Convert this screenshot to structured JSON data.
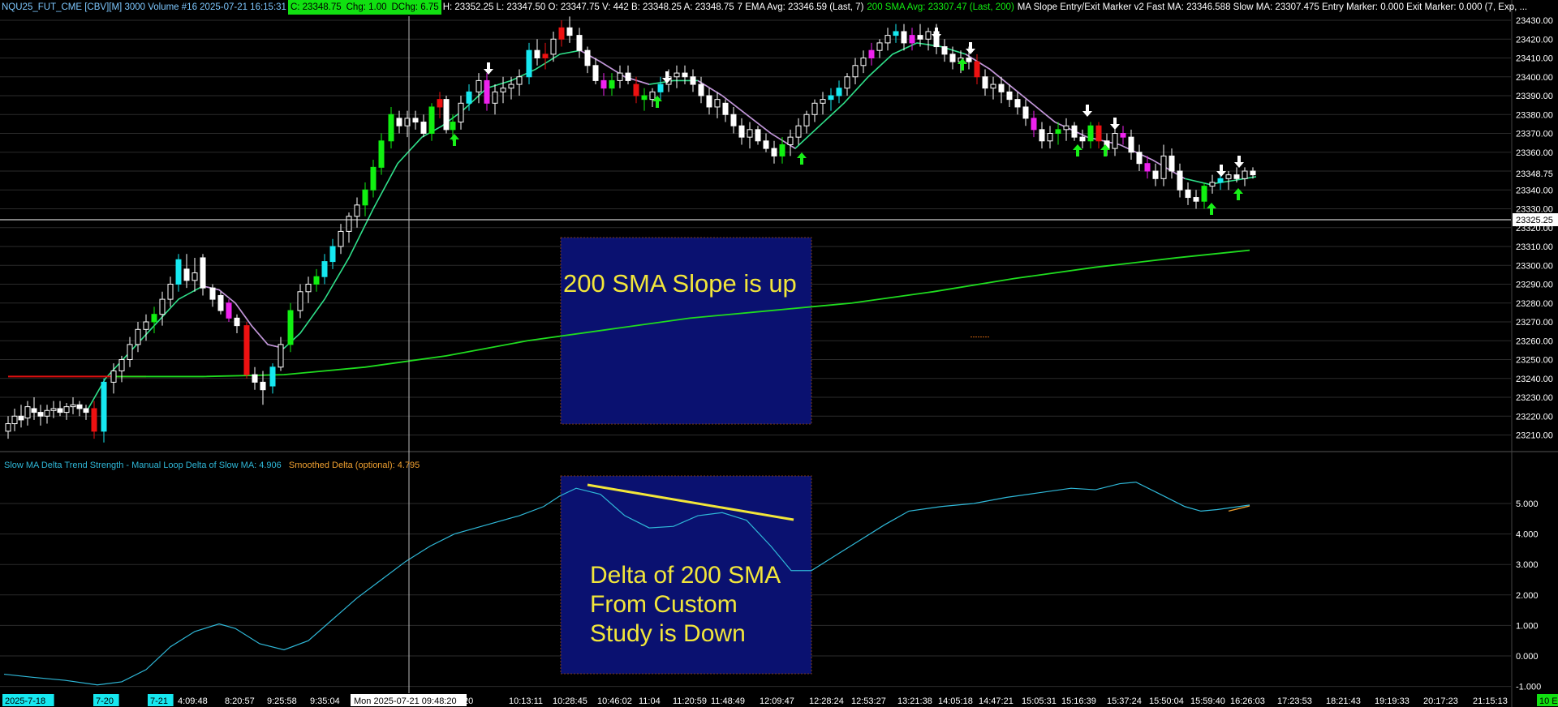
{
  "header": {
    "symbol": "NQU25_FUT_CME [CBV][M]  3000 Volume #16 2025-07-21 16:15:31",
    "close": "C: 23348.75",
    "change": "Chg: 1.00",
    "dchange": "DChg: 6.75",
    "ohlc": "H: 23352.25  L: 23347.50  O: 23347.75  V: 442  B: 23348.25  A: 23348.75",
    "ema": "7 EMA  Avg: 23346.59  (Last, 7)",
    "sma": "200 SMA  Avg: 23307.47  (Last, 200)",
    "marker": "MA Slope Entry/Exit Marker v2  Fast MA: 23346.588  Slow MA: 23307.475  Entry Marker: 0.000  Exit Marker: 0.000  (7, Exp, ..."
  },
  "subgraph": {
    "title": "Slow MA Delta Trend Strength - Manual Loop  Delta of Slow MA: 4.906",
    "smoothed": "Smoothed Delta (optional): 4.795"
  },
  "annotations": {
    "upper_box_text": "200 SMA Slope is up",
    "lower_box_line1": "Delta of 200 SMA",
    "lower_box_line2": "From Custom",
    "lower_box_line3": "Study is Down"
  },
  "price_axis": {
    "ticks": [
      "23430.00",
      "23420.00",
      "23410.00",
      "23400.00",
      "23390.00",
      "23380.00",
      "23370.00",
      "23360.00",
      "23350.00",
      "23340.00",
      "23330.00",
      "23320.00",
      "23310.00",
      "23300.00",
      "23290.00",
      "23280.00",
      "23270.00",
      "23260.00",
      "23250.00",
      "23240.00",
      "23230.00",
      "23220.00",
      "23210.00"
    ],
    "last_price_label": "23348.75",
    "crosshair_price_label": "23325.25"
  },
  "delta_axis": {
    "ticks": [
      "5.000",
      "4.000",
      "3.000",
      "2.000",
      "1.000",
      "0.000",
      "-1.000"
    ]
  },
  "time_axis": {
    "labels": [
      "2025-7-18",
      "7-20",
      "7-21",
      "4:09:48",
      "8:20:57",
      "9:25:58",
      "9:35:04",
      "20",
      "10:13:11",
      "10:28:45",
      "10:46:02",
      "11:04",
      "11:20:59",
      "11:48:49",
      "12:09:47",
      "12:28:24",
      "12:53:27",
      "13:21:38",
      "14:05:18",
      "14:47:21",
      "15:05:31",
      "15:16:39",
      "15:37:24",
      "15:50:04",
      "15:59:40",
      "16:26:03",
      "17:23:53",
      "18:21:43",
      "19:19:33",
      "20:17:23",
      "21:15:13"
    ],
    "crosshair_time_label": "Mon 2025-07-21  09:48:20",
    "corner_label": "10 E"
  },
  "colors": {
    "ema": "#2fe08a",
    "ema_down": "#c88bd8",
    "sma": "#1fdc1f",
    "sma_flat": "#e01010",
    "delta": "#2fb8d8",
    "trend_line": "#f2e63a",
    "bull": "#ffffff",
    "bear": "#000000",
    "strong_bull": "#16e8f0",
    "strong_bull2": "#11f011",
    "strong_bear": "#ee1111",
    "strong_bear2": "#ee22ee",
    "entry_arrow": "#18f018",
    "exit_arrow": "#ffffff",
    "box_fill": "#0a1170",
    "box_text": "#f2e63a"
  }
}
